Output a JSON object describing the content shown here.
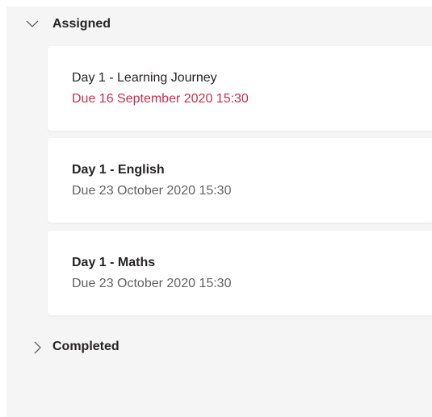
{
  "sections": {
    "assigned": {
      "label": "Assigned",
      "expanded": true,
      "icon": "chevron-down-icon"
    },
    "completed": {
      "label": "Completed",
      "expanded": false,
      "icon": "chevron-right-icon"
    }
  },
  "assignments": [
    {
      "title": "Day 1 - Learning Journey",
      "due": "Due 16 September 2020 15:30",
      "overdue": true
    },
    {
      "title": "Day 1 - English",
      "due": "Due 23 October 2020 15:30",
      "overdue": false
    },
    {
      "title": "Day 1 - Maths",
      "due": "Due 23 October 2020 15:30",
      "overdue": false
    }
  ],
  "colors": {
    "panel_bg": "#f5f5f5",
    "card_bg": "#ffffff",
    "text_primary": "#252423",
    "text_secondary": "#616161",
    "overdue": "#c4314b"
  }
}
